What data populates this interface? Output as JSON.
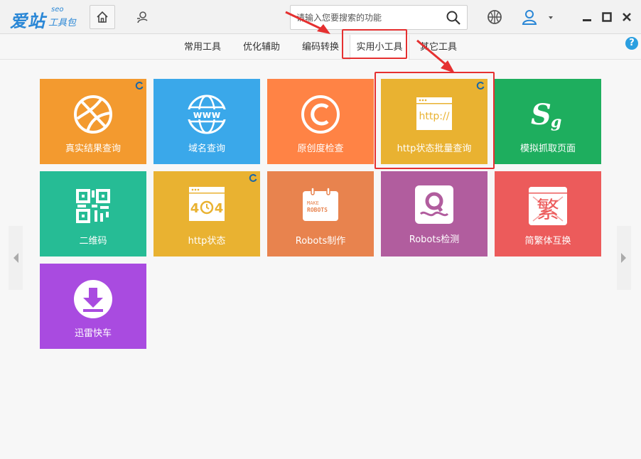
{
  "app": {
    "logo_main": "爱站",
    "logo_seo": "seo",
    "logo_sub": "工具包"
  },
  "search": {
    "placeholder": "请输入您要搜索的功能"
  },
  "tabs": [
    {
      "label": "常用工具"
    },
    {
      "label": "优化辅助"
    },
    {
      "label": "编码转换"
    },
    {
      "label": "实用小工具",
      "active": true
    },
    {
      "label": "其它工具"
    }
  ],
  "tiles": [
    {
      "label": "真实结果查询",
      "color": "#f39a2f",
      "icon": "basketball-icon",
      "loading": true
    },
    {
      "label": "域名查询",
      "color": "#3aa8ea",
      "icon": "www-globe-icon"
    },
    {
      "label": "原创度检查",
      "color": "#ff8345",
      "icon": "copyright-icon"
    },
    {
      "label": "http状态批量查询",
      "color": "#e9b231",
      "icon": "http-window-icon",
      "loading": true
    },
    {
      "label": "模拟抓取页面",
      "color": "#1eae5e",
      "icon": "sg-icon",
      "icon_text": "Sg"
    },
    {
      "label": "二维码",
      "color": "#26bc95",
      "icon": "qr-code-icon"
    },
    {
      "label": "http状态",
      "color": "#e9b231",
      "icon": "error-404-icon",
      "icon_text": "404",
      "loading": true
    },
    {
      "label": "Robots制作",
      "color": "#e8834e",
      "icon": "make-robots-icon",
      "icon_text_1": "MAKE",
      "icon_text_2": "ROBOTS"
    },
    {
      "label": "Robots检测",
      "color": "#b15d9e",
      "icon": "robots-check-icon"
    },
    {
      "label": "简繁体互换",
      "color": "#ec5b5b",
      "icon": "traditional-char-icon",
      "icon_text": "繁"
    },
    {
      "label": "迅雷快车",
      "color": "#a94be0",
      "icon": "download-icon"
    }
  ],
  "colors": {
    "brand": "#2a87d6",
    "annotation": "#e53030",
    "help": "#2b9fe0"
  }
}
